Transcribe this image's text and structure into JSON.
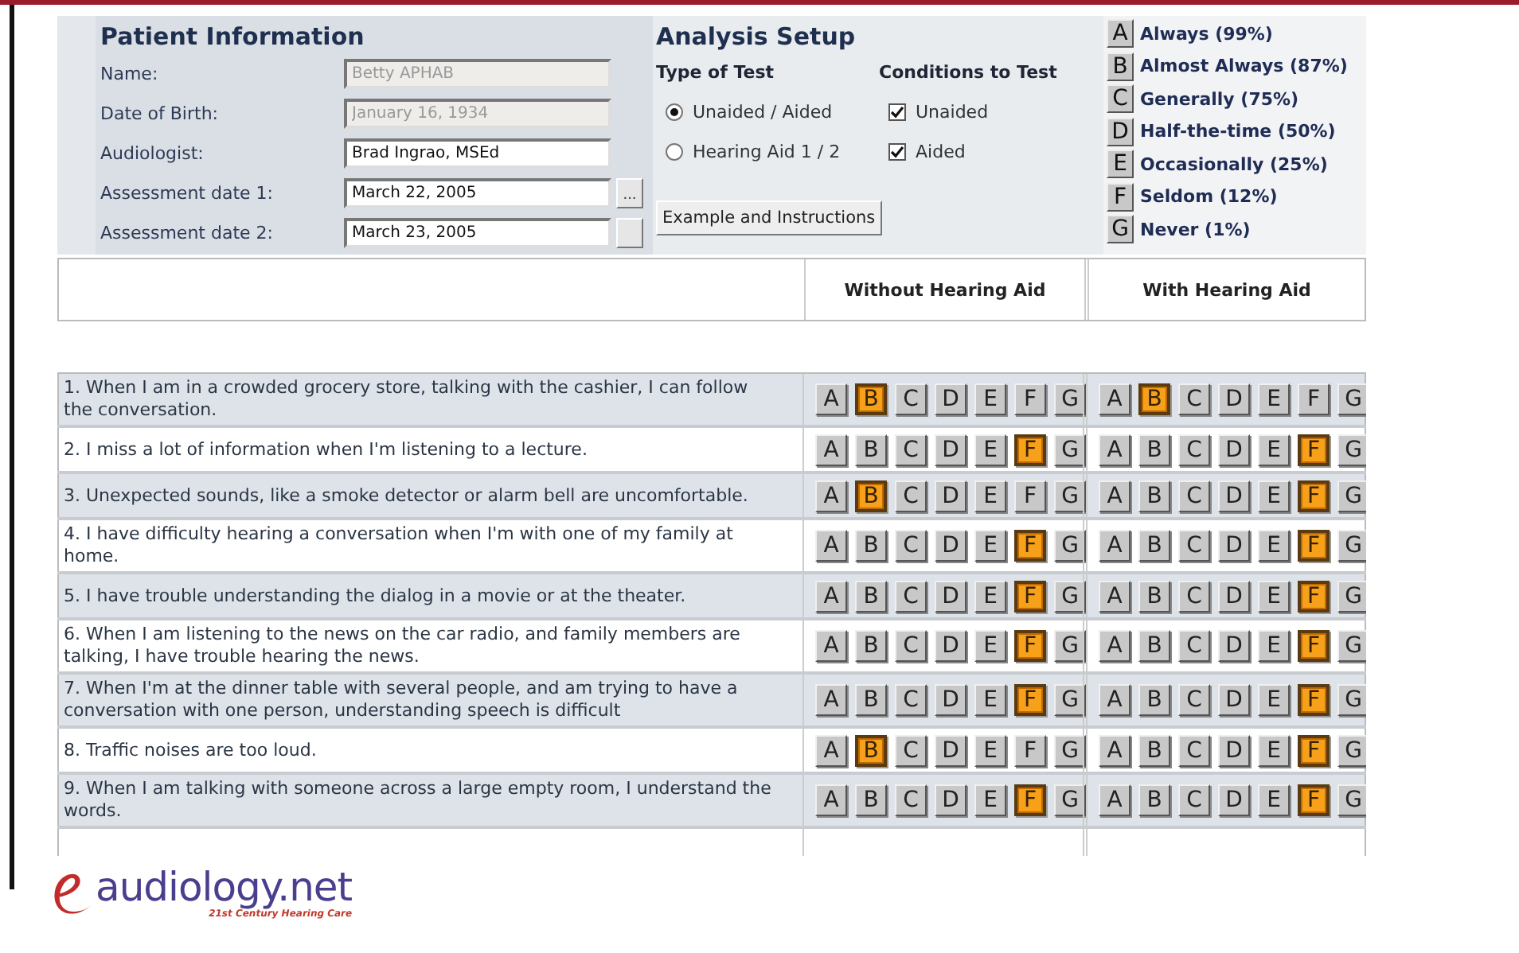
{
  "patient_information": {
    "title": "Patient Information",
    "fields": [
      {
        "label": "Name:",
        "value": "Betty APHAB",
        "disabled": true
      },
      {
        "label": "Date of Birth:",
        "value": "January 16, 1934",
        "disabled": true
      },
      {
        "label": "Audiologist:",
        "value": "Brad Ingrao, MSEd",
        "disabled": false
      },
      {
        "label": "Assessment date 1:",
        "value": "March 22, 2005",
        "disabled": false,
        "picker": true,
        "button": "..."
      },
      {
        "label": "Assessment date 2:",
        "value": "March 23, 2005",
        "disabled": false,
        "picker": true
      }
    ]
  },
  "analysis_setup": {
    "title": "Analysis Setup",
    "type_of_test_heading": "Type of Test",
    "conditions_heading": "Conditions to Test",
    "test_types": [
      {
        "label": "Unaided / Aided",
        "selected": true
      },
      {
        "label": "Hearing Aid 1 / 2",
        "selected": false
      }
    ],
    "conditions": [
      {
        "label": "Unaided",
        "checked": true
      },
      {
        "label": "Aided",
        "checked": true
      }
    ],
    "example_button": "Example and Instructions"
  },
  "legend": [
    {
      "key": "A",
      "label": "Always (99%)"
    },
    {
      "key": "B",
      "label": "Almost Always (87%)"
    },
    {
      "key": "C",
      "label": "Generally (75%)"
    },
    {
      "key": "D",
      "label": "Half-the-time (50%)"
    },
    {
      "key": "E",
      "label": "Occasionally (25%)"
    },
    {
      "key": "F",
      "label": "Seldom (12%)"
    },
    {
      "key": "G",
      "label": "Never (1%)"
    }
  ],
  "table": {
    "columns": [
      "Without Hearing Aid",
      "With Hearing Aid"
    ],
    "questions": [
      {
        "text": "1. When I am in a crowded grocery store, talking with the cashier, I can follow the conversation.",
        "without": [
          {
            "letter": "A",
            "selected": false
          },
          {
            "letter": "B",
            "selected": true
          },
          {
            "letter": "C",
            "selected": false
          },
          {
            "letter": "D",
            "selected": false
          },
          {
            "letter": "E",
            "selected": false
          },
          {
            "letter": "F",
            "selected": false
          },
          {
            "letter": "G",
            "selected": false
          }
        ],
        "with": [
          {
            "letter": "A",
            "selected": false
          },
          {
            "letter": "B",
            "selected": true
          },
          {
            "letter": "C",
            "selected": false
          },
          {
            "letter": "D",
            "selected": false
          },
          {
            "letter": "E",
            "selected": false
          },
          {
            "letter": "F",
            "selected": false
          },
          {
            "letter": "G",
            "selected": false
          }
        ]
      },
      {
        "text": "2. I miss a lot of information when I'm listening to a lecture.",
        "without": [
          {
            "letter": "A",
            "selected": false
          },
          {
            "letter": "B",
            "selected": false
          },
          {
            "letter": "C",
            "selected": false
          },
          {
            "letter": "D",
            "selected": false
          },
          {
            "letter": "E",
            "selected": false
          },
          {
            "letter": "F",
            "selected": true
          },
          {
            "letter": "G",
            "selected": false
          }
        ],
        "with": [
          {
            "letter": "A",
            "selected": false
          },
          {
            "letter": "B",
            "selected": false
          },
          {
            "letter": "C",
            "selected": false
          },
          {
            "letter": "D",
            "selected": false
          },
          {
            "letter": "E",
            "selected": false
          },
          {
            "letter": "F",
            "selected": true
          },
          {
            "letter": "G",
            "selected": false
          }
        ]
      },
      {
        "text": "3. Unexpected sounds, like a smoke detector or alarm bell are uncomfortable.",
        "without": [
          {
            "letter": "A",
            "selected": false
          },
          {
            "letter": "B",
            "selected": true
          },
          {
            "letter": "C",
            "selected": false
          },
          {
            "letter": "D",
            "selected": false
          },
          {
            "letter": "E",
            "selected": false
          },
          {
            "letter": "F",
            "selected": false
          },
          {
            "letter": "G",
            "selected": false
          }
        ],
        "with": [
          {
            "letter": "A",
            "selected": false
          },
          {
            "letter": "B",
            "selected": false
          },
          {
            "letter": "C",
            "selected": false
          },
          {
            "letter": "D",
            "selected": false
          },
          {
            "letter": "E",
            "selected": false
          },
          {
            "letter": "F",
            "selected": true
          },
          {
            "letter": "G",
            "selected": false
          }
        ]
      },
      {
        "text": "4. I have difficulty hearing a conversation when I'm with one of my family at home.",
        "without": [
          {
            "letter": "A",
            "selected": false
          },
          {
            "letter": "B",
            "selected": false
          },
          {
            "letter": "C",
            "selected": false
          },
          {
            "letter": "D",
            "selected": false
          },
          {
            "letter": "E",
            "selected": false
          },
          {
            "letter": "F",
            "selected": true
          },
          {
            "letter": "G",
            "selected": false
          }
        ],
        "with": [
          {
            "letter": "A",
            "selected": false
          },
          {
            "letter": "B",
            "selected": false
          },
          {
            "letter": "C",
            "selected": false
          },
          {
            "letter": "D",
            "selected": false
          },
          {
            "letter": "E",
            "selected": false
          },
          {
            "letter": "F",
            "selected": true
          },
          {
            "letter": "G",
            "selected": false
          }
        ]
      },
      {
        "text": "5. I have trouble understanding the dialog in a movie or at the theater.",
        "without": [
          {
            "letter": "A",
            "selected": false
          },
          {
            "letter": "B",
            "selected": false
          },
          {
            "letter": "C",
            "selected": false
          },
          {
            "letter": "D",
            "selected": false
          },
          {
            "letter": "E",
            "selected": false
          },
          {
            "letter": "F",
            "selected": true
          },
          {
            "letter": "G",
            "selected": false
          }
        ],
        "with": [
          {
            "letter": "A",
            "selected": false
          },
          {
            "letter": "B",
            "selected": false
          },
          {
            "letter": "C",
            "selected": false
          },
          {
            "letter": "D",
            "selected": false
          },
          {
            "letter": "E",
            "selected": false
          },
          {
            "letter": "F",
            "selected": true
          },
          {
            "letter": "G",
            "selected": false
          }
        ]
      },
      {
        "text": "6. When I am listening to the news on the car radio, and family members are talking, I have trouble hearing the news.",
        "without": [
          {
            "letter": "A",
            "selected": false
          },
          {
            "letter": "B",
            "selected": false
          },
          {
            "letter": "C",
            "selected": false
          },
          {
            "letter": "D",
            "selected": false
          },
          {
            "letter": "E",
            "selected": false
          },
          {
            "letter": "F",
            "selected": true
          },
          {
            "letter": "G",
            "selected": false
          }
        ],
        "with": [
          {
            "letter": "A",
            "selected": false
          },
          {
            "letter": "B",
            "selected": false
          },
          {
            "letter": "C",
            "selected": false
          },
          {
            "letter": "D",
            "selected": false
          },
          {
            "letter": "E",
            "selected": false
          },
          {
            "letter": "F",
            "selected": true
          },
          {
            "letter": "G",
            "selected": false
          }
        ]
      },
      {
        "text": "7. When I'm at the dinner table with several people, and am trying to have a conversation with one person, understanding speech is difficult",
        "without": [
          {
            "letter": "A",
            "selected": false
          },
          {
            "letter": "B",
            "selected": false
          },
          {
            "letter": "C",
            "selected": false
          },
          {
            "letter": "D",
            "selected": false
          },
          {
            "letter": "E",
            "selected": false
          },
          {
            "letter": "F",
            "selected": true
          },
          {
            "letter": "G",
            "selected": false
          }
        ],
        "with": [
          {
            "letter": "A",
            "selected": false
          },
          {
            "letter": "B",
            "selected": false
          },
          {
            "letter": "C",
            "selected": false
          },
          {
            "letter": "D",
            "selected": false
          },
          {
            "letter": "E",
            "selected": false
          },
          {
            "letter": "F",
            "selected": true
          },
          {
            "letter": "G",
            "selected": false
          }
        ]
      },
      {
        "text": "8. Traffic noises are too loud.",
        "without": [
          {
            "letter": "A",
            "selected": false
          },
          {
            "letter": "B",
            "selected": true
          },
          {
            "letter": "C",
            "selected": false
          },
          {
            "letter": "D",
            "selected": false
          },
          {
            "letter": "E",
            "selected": false
          },
          {
            "letter": "F",
            "selected": false
          },
          {
            "letter": "G",
            "selected": false
          }
        ],
        "with": [
          {
            "letter": "A",
            "selected": false
          },
          {
            "letter": "B",
            "selected": false
          },
          {
            "letter": "C",
            "selected": false
          },
          {
            "letter": "D",
            "selected": false
          },
          {
            "letter": "E",
            "selected": false
          },
          {
            "letter": "F",
            "selected": true
          },
          {
            "letter": "G",
            "selected": false
          }
        ]
      },
      {
        "text": "9. When I am talking with someone across a large empty room, I understand the words.",
        "without": [
          {
            "letter": "A",
            "selected": false
          },
          {
            "letter": "B",
            "selected": false
          },
          {
            "letter": "C",
            "selected": false
          },
          {
            "letter": "D",
            "selected": false
          },
          {
            "letter": "E",
            "selected": false
          },
          {
            "letter": "F",
            "selected": true
          },
          {
            "letter": "G",
            "selected": false
          }
        ],
        "with": [
          {
            "letter": "A",
            "selected": false
          },
          {
            "letter": "B",
            "selected": false
          },
          {
            "letter": "C",
            "selected": false
          },
          {
            "letter": "D",
            "selected": false
          },
          {
            "letter": "E",
            "selected": false
          },
          {
            "letter": "F",
            "selected": true
          },
          {
            "letter": "G",
            "selected": false
          }
        ]
      }
    ]
  },
  "logo": {
    "name": "audiology.net",
    "tagline": "21st Century Hearing Care"
  }
}
